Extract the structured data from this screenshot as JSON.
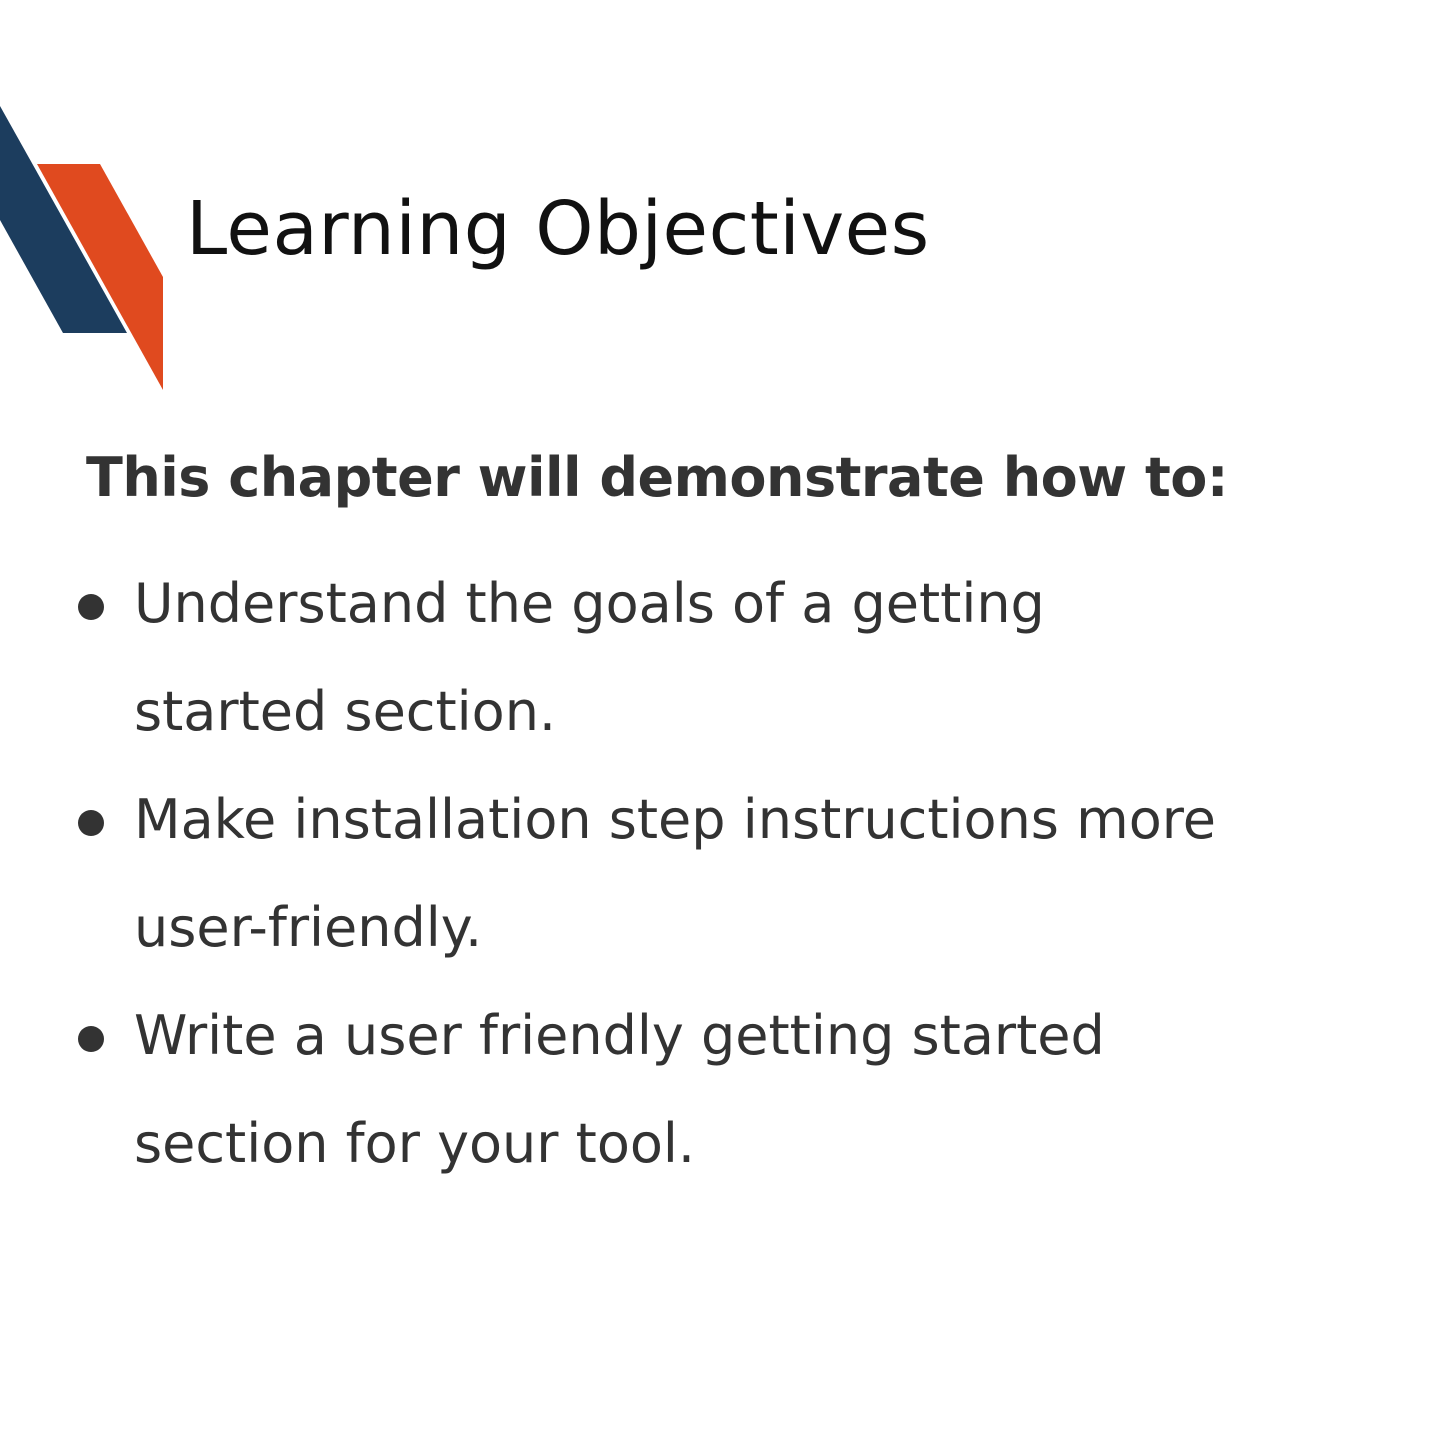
{
  "title": "Learning Objectives",
  "intro": "This chapter will demonstrate how to:",
  "objectives": [
    {
      "line1": "Understand the goals of a getting",
      "line2": "started section."
    },
    {
      "line1": "Make installation step instructions more",
      "line2": "user-friendly."
    },
    {
      "line1": "Write a user friendly getting started",
      "line2": "section for your tool."
    }
  ],
  "colors": {
    "navy": "#1c3d5e",
    "orange": "#e04a1f"
  }
}
